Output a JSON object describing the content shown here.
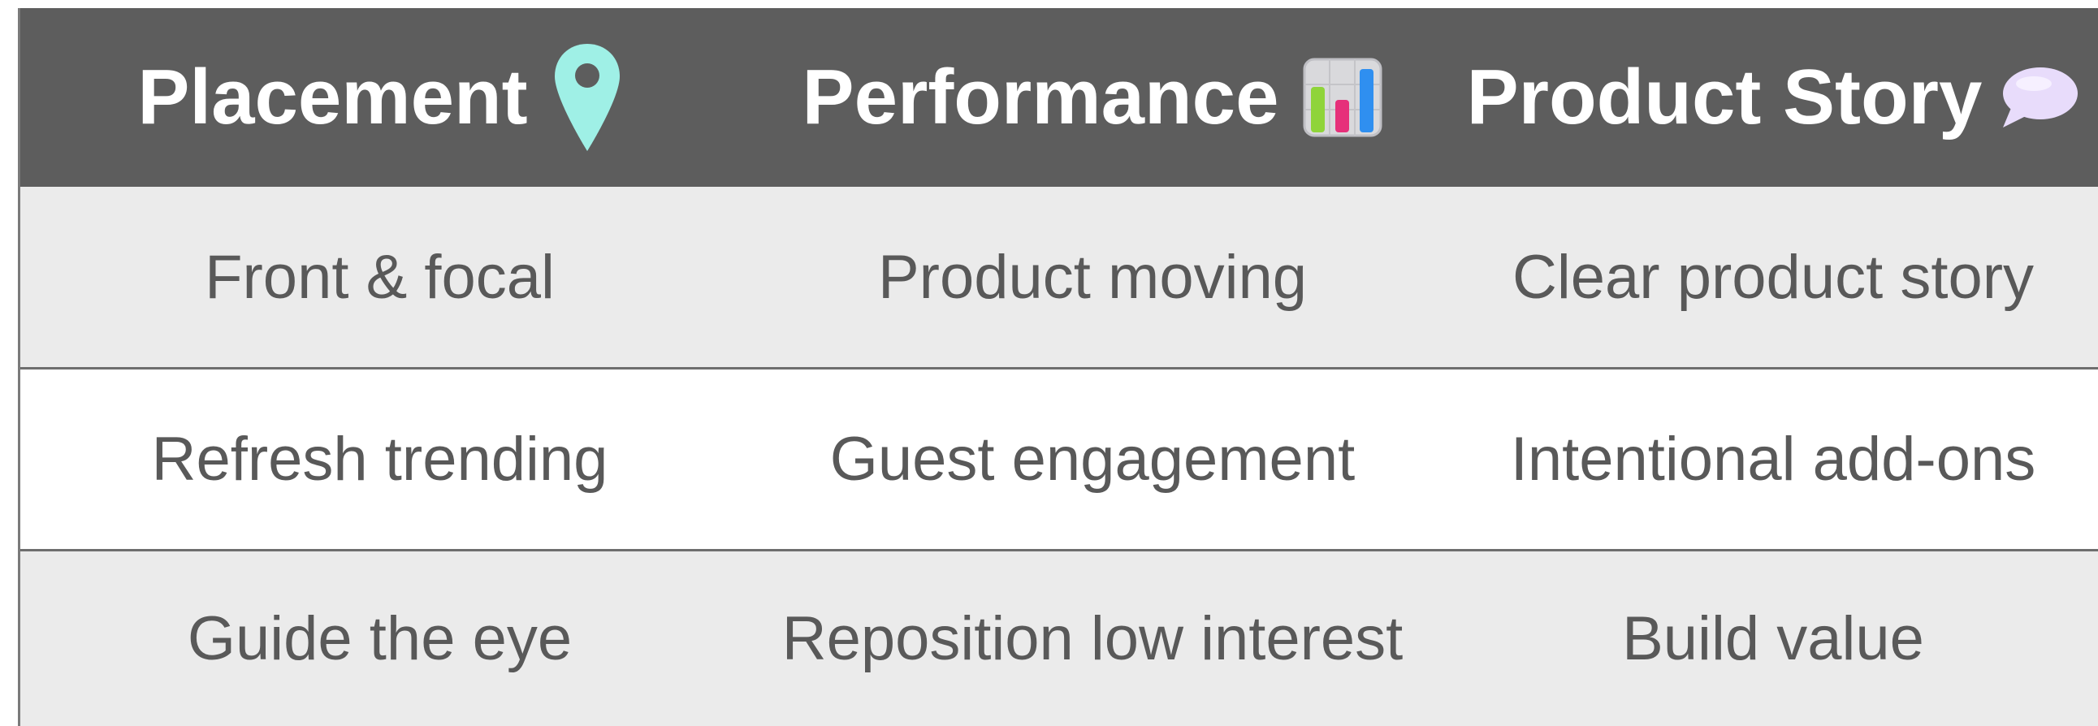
{
  "table": {
    "headers": [
      {
        "label": "Placement",
        "icon": "map-pin-icon",
        "icon_color": "#9ff0e6"
      },
      {
        "label": "Performance",
        "icon": "bar-chart-icon"
      },
      {
        "label": "Product Story",
        "icon": "speech-bubble-icon",
        "icon_color": "#e8dcfb"
      }
    ],
    "rows": [
      [
        "Front & focal",
        "Product moving",
        "Clear product story"
      ],
      [
        "Refresh trending",
        "Guest engagement",
        "Intentional add-ons"
      ],
      [
        "Guide the eye",
        "Reposition low interest",
        "Build value"
      ]
    ]
  },
  "colors": {
    "header_bg": "#5d5d5d",
    "row_shaded": "#ebebeb",
    "row_white": "#ffffff",
    "text": "#595959"
  }
}
